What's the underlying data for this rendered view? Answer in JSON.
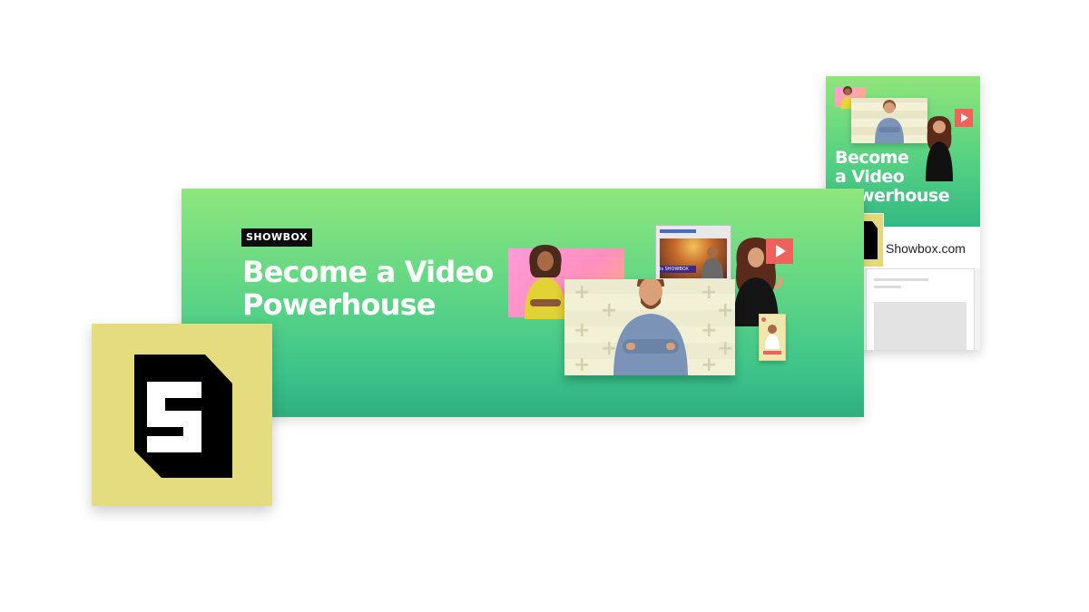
{
  "cover_banner": {
    "brand_tag": "SHOWBOX",
    "title_line_1": "Become a Video",
    "title_line_2": "Powerhouse",
    "screen_caption": "is SHOWBOX"
  },
  "mobile_preview": {
    "title_line_1": "Become",
    "title_line_2": "a Video",
    "title_line_3": "Powerhouse",
    "page_name": "Showbox.com"
  },
  "logo": {
    "letter": "S",
    "background_color": "#e5dc7f",
    "shape_color": "#000000"
  },
  "colors": {
    "banner_top": "#8ee67d",
    "banner_bottom": "#2fae80",
    "accent_red": "#f0615c",
    "accent_pink": "#ff9bd8"
  }
}
